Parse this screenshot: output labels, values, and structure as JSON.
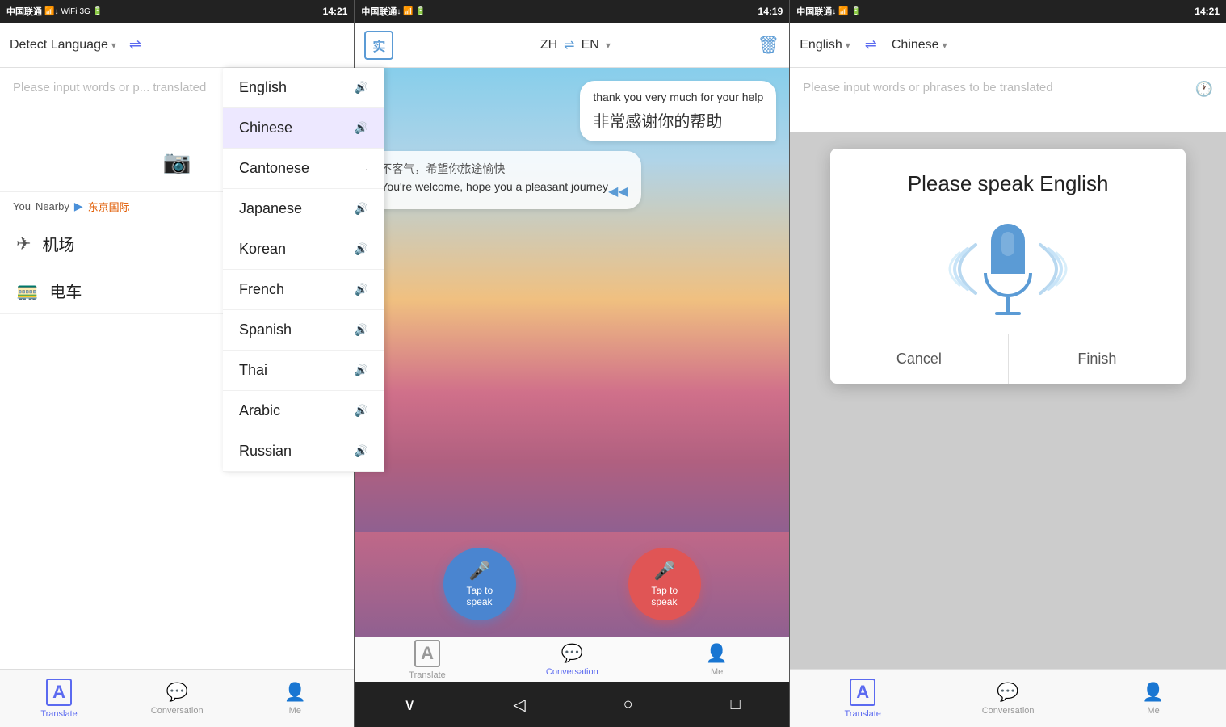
{
  "panel1": {
    "status": {
      "carrier": "中国联通",
      "time": "14:21",
      "signal": "3G"
    },
    "header": {
      "detect_language": "Detect Language",
      "swap_label": "⇌"
    },
    "input": {
      "placeholder": "Please input words or p... translated"
    },
    "nearby": {
      "label": "You",
      "nearby_text": "Nearby",
      "destination": "东京国际"
    },
    "items": [
      {
        "icon": "✈",
        "label": "机场"
      },
      {
        "icon": "🚃",
        "label": "电车"
      }
    ],
    "dropdown": {
      "current": "Chinese",
      "options": [
        {
          "label": "English",
          "active": false
        },
        {
          "label": "Chinese",
          "active": true
        },
        {
          "label": "Cantonese",
          "active": false
        },
        {
          "label": "Japanese",
          "active": false
        },
        {
          "label": "Korean",
          "active": false
        },
        {
          "label": "French",
          "active": false
        },
        {
          "label": "Spanish",
          "active": false
        },
        {
          "label": "Thai",
          "active": false
        },
        {
          "label": "Arabic",
          "active": false
        },
        {
          "label": "Russian",
          "active": false
        }
      ]
    },
    "bottom_nav": [
      {
        "label": "Translate",
        "icon": "A",
        "active": true
      },
      {
        "label": "Conversation",
        "icon": "💬",
        "active": false
      },
      {
        "label": "Me",
        "icon": "👤",
        "active": false
      }
    ]
  },
  "panel2": {
    "status": {
      "carrier": "中国联通",
      "time": "14:19"
    },
    "header": {
      "translate_icon": "实",
      "lang_from": "ZH",
      "swap": "⇌",
      "lang_to": "EN",
      "delete": "🗑"
    },
    "messages": [
      {
        "side": "right",
        "en": "thank you very much for your help",
        "zh": "非常感谢你的帮助"
      },
      {
        "side": "left",
        "zh": "不客气，希望你旅途愉快",
        "en": "You're welcome, hope you a pleasant journey"
      }
    ],
    "tap_buttons": [
      {
        "label": "Tap to speak",
        "color": "blue"
      },
      {
        "label": "Tap to speak",
        "color": "red"
      }
    ],
    "bottom_nav": [
      {
        "label": "Translate",
        "icon": "A",
        "active": false
      },
      {
        "label": "Conversation",
        "icon": "💬",
        "active": true
      },
      {
        "label": "Me",
        "icon": "👤",
        "active": false
      }
    ],
    "android_nav": [
      "∨",
      "◁",
      "○",
      "□"
    ]
  },
  "panel3": {
    "status": {
      "carrier": "中国联通",
      "time": "14:21"
    },
    "header": {
      "lang_left": "English",
      "swap": "⇌",
      "lang_right": "Chinese"
    },
    "input": {
      "placeholder": "Please input words or phrases to be translated"
    },
    "modal": {
      "title": "Please speak English",
      "cancel": "Cancel",
      "finish": "Finish"
    },
    "bottom_nav": [
      {
        "label": "Translate",
        "icon": "A",
        "active": true
      },
      {
        "label": "Conversation",
        "icon": "💬",
        "active": false
      },
      {
        "label": "Me",
        "icon": "👤",
        "active": false
      }
    ]
  }
}
